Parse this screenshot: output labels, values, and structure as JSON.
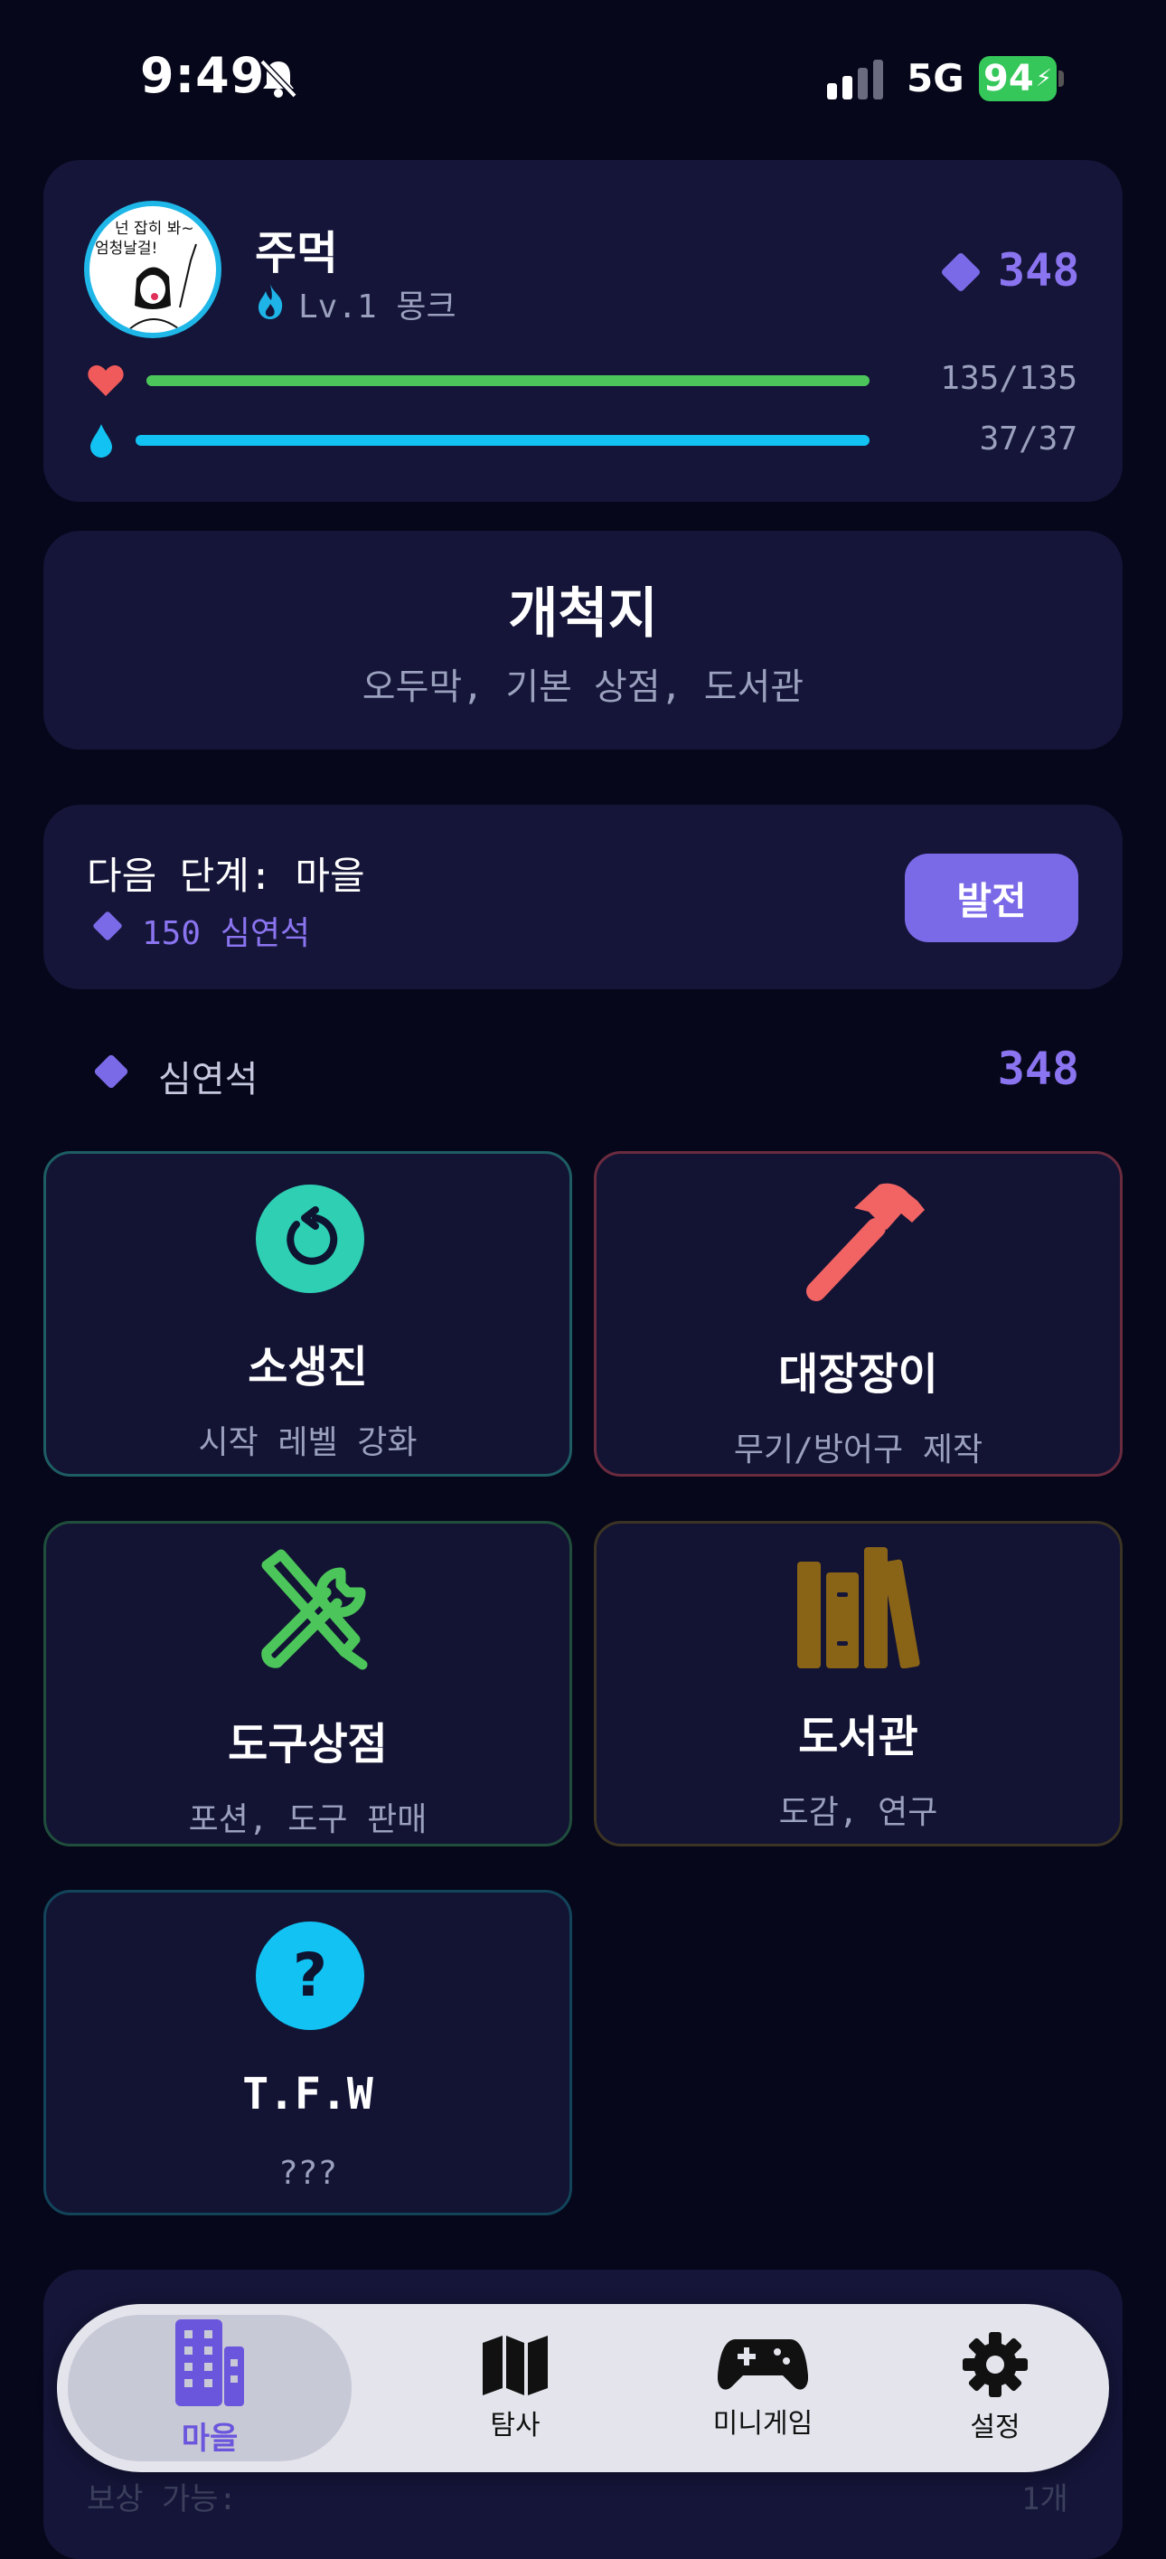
{
  "status_bar": {
    "time": "9:49",
    "network": "5G",
    "battery": "94"
  },
  "profile": {
    "name": "주먹",
    "level": "Lv.1 몽크",
    "gems": "348",
    "hp": {
      "text": "135/135",
      "fraction": 1.0
    },
    "mp": {
      "text": "37/37",
      "fraction": 1.0
    },
    "avatar_text": "넌 잡히 봐~ 엄청날걸!"
  },
  "location": {
    "title": "개척지",
    "facilities": "오두막, 기본 상점, 도서관"
  },
  "next_stage": {
    "title": "다음 단계: 마을",
    "cost": "150 심연석",
    "button": "발전"
  },
  "currency": {
    "label": "심연석",
    "value": "348"
  },
  "buildings": [
    {
      "title": "소생진",
      "subtitle": "시작 레벨 강화",
      "icon": "revive-icon",
      "color": "#2ecfb3"
    },
    {
      "title": "대장장이",
      "subtitle": "무기/방어구 제작",
      "icon": "hammer-icon",
      "color": "#f26464"
    },
    {
      "title": "도구상점",
      "subtitle": "포션, 도구 판매",
      "icon": "tools-icon",
      "color": "#4cc65a"
    },
    {
      "title": "도서관",
      "subtitle": "도감, 연구",
      "icon": "books-icon",
      "color": "#8a6416"
    },
    {
      "title": "T.F.W",
      "subtitle": "???",
      "icon": "question-icon",
      "color": "#12c2f2"
    }
  ],
  "tabs": [
    {
      "label": "마을",
      "icon": "building-icon",
      "active": true
    },
    {
      "label": "탐사",
      "icon": "map-icon",
      "active": false
    },
    {
      "label": "미니게임",
      "icon": "gamepad-icon",
      "active": false
    },
    {
      "label": "설정",
      "icon": "gear-icon",
      "active": false
    }
  ],
  "bottom_card": {
    "reward_label": "보상 가능:",
    "reward_count": "1개"
  }
}
